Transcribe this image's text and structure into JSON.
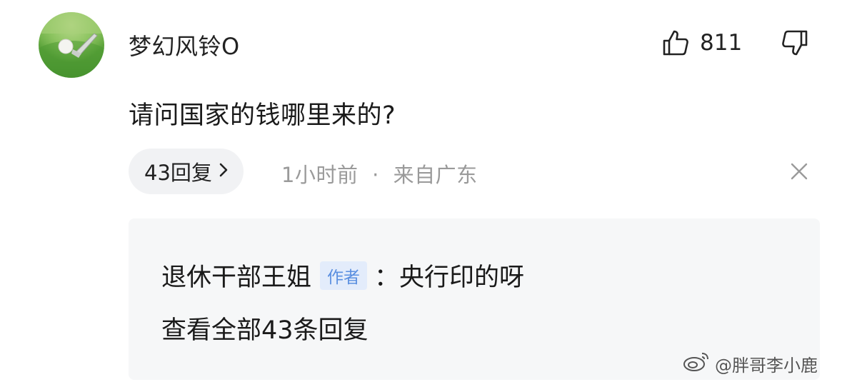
{
  "comment": {
    "username": "梦幻风铃O",
    "text": "请问国家的钱哪里来的?",
    "like_count": "811",
    "reply_count_label": "43回复",
    "time": "1小时前",
    "separator": "·",
    "location": "来自广东",
    "icons": {
      "like": "thumbs-up-icon",
      "dislike": "thumbs-down-icon",
      "reply_chevron": "chevron-right-icon",
      "close": "close-icon"
    }
  },
  "reply_preview": {
    "author": "退休干部王姐",
    "badge": "作者",
    "text": "：央行印的呀",
    "view_all": "查看全部43条回复"
  },
  "watermark": {
    "text": "@胖哥李小鹿",
    "icon": "weibo-logo-icon"
  },
  "colors": {
    "badge_bg": "#e3ecfb",
    "badge_text": "#5a8fe0",
    "meta_text": "#9a9a9a",
    "pill_bg": "#f1f2f4",
    "reply_box_bg": "#f6f7f8"
  }
}
